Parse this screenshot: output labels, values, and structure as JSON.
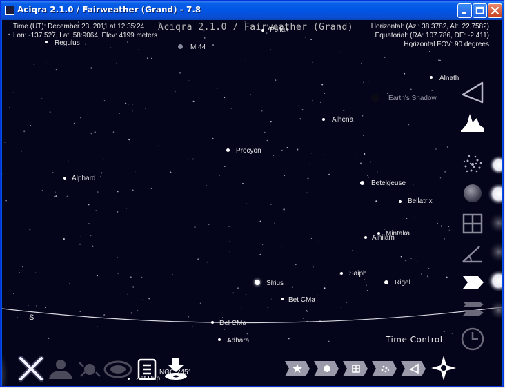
{
  "window": {
    "title": "Aciqra 2.1.0 / Fairweather (Grand) - 7.8"
  },
  "overlay": {
    "app_name": "Aciqra 2.1.0 / Fairweather (Grand)",
    "time": "Time (UT): December 23, 2011 at 12:35:24",
    "location": "Lon: -137.527, Lat: 58.9064, Elev: 4199 meters",
    "horizontal": "Horizontal: (Azi: 38.3782, Alt: 22.7582)",
    "equatorial": "Equatorial: (RA: 107.786, DE: -2.411)",
    "fov": "Horizontal FOV: 90 degrees"
  },
  "labels": {
    "pollux": "Pollux",
    "regulus": "Regulus",
    "m44": "M 44",
    "alnath": "Alnath",
    "earths_shadow": "Earth's Shadow",
    "alhena": "Alhena",
    "procyon": "Procyon",
    "alphard": "Alphard",
    "betelgeuse": "Betelgeuse",
    "bellatrix": "Bellatrix",
    "mintaka": "Mintaka",
    "alnilam": "Alnilam",
    "saiph": "Saiph",
    "rigel": "Rigel",
    "sirius": "Sirius",
    "bet_cma": "Bet CMa",
    "del_cma": "Del CMa",
    "adhara": "Adhara",
    "ngc": "NGC 2451",
    "zet_pup": "Zet Pup",
    "south": "S"
  },
  "toolbar": {
    "time_control": "Time Control"
  },
  "icons": {
    "right_toolbar": [
      "triangle-icon",
      "mountain-icon",
      "starfield-icon",
      "planet-icon",
      "grid-icon",
      "angle-icon",
      "arrow-icon",
      "constellation-lines-icon",
      "clock-icon"
    ],
    "bottom_left": [
      "close-icon",
      "person-icon",
      "satellite-icon",
      "galaxy-icon",
      "document-icon",
      "download-icon"
    ],
    "bottom_right": [
      "star-tab-icon",
      "dot-tab-icon",
      "grid-tab-icon",
      "cluster-tab-icon",
      "triangle-tab-icon",
      "compass-icon"
    ]
  },
  "colors": {
    "sky": "#04041a",
    "titlebar": "#0055e5",
    "label": "#e6e6e6"
  }
}
